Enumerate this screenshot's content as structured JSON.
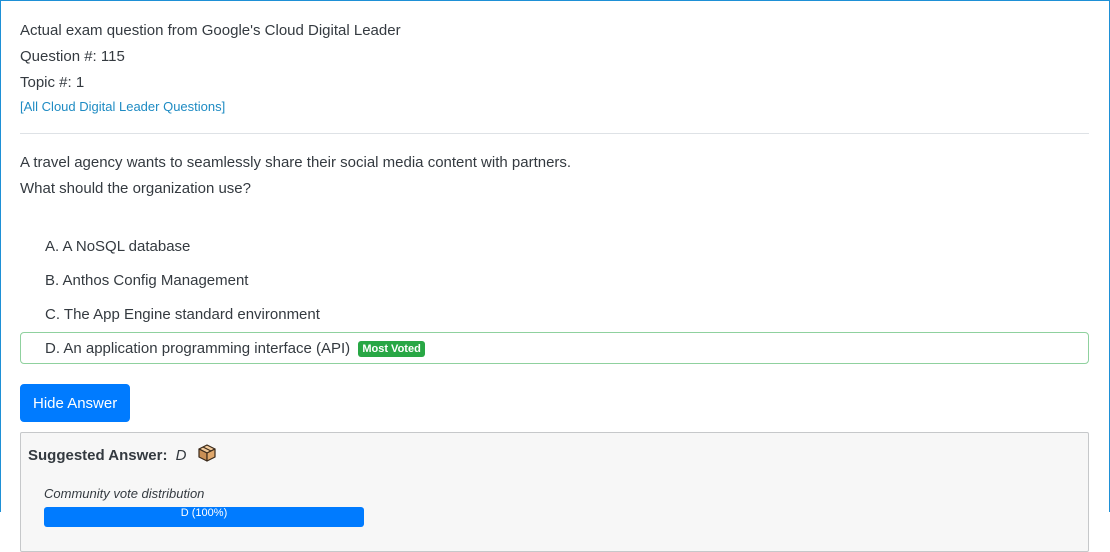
{
  "header": {
    "intro": "Actual exam question from Google's Cloud Digital Leader",
    "question_number": "Question #: 115",
    "topic": "Topic #: 1",
    "all_questions_link": "[All Cloud Digital Leader Questions]"
  },
  "question": {
    "line1": "A travel agency wants to seamlessly share their social media content with partners.",
    "line2": "What should the organization use?"
  },
  "choices": [
    {
      "letter": "A.",
      "text": "A NoSQL database"
    },
    {
      "letter": "B.",
      "text": "Anthos Config Management"
    },
    {
      "letter": "C.",
      "text": "The App Engine standard environment"
    },
    {
      "letter": "D.",
      "text": "An application programming interface (API)",
      "badge": "Most Voted"
    }
  ],
  "answer_button": "Hide Answer",
  "suggested": {
    "label": "Suggested Answer:",
    "value": "D",
    "icon": "cardboard-box-icon"
  },
  "vote": {
    "label": "Community vote distribution",
    "bar_text": "D (100%)",
    "percent": 100
  },
  "colors": {
    "link": "#1e8bc3",
    "button": "#007bff",
    "badge": "#28a745",
    "correct_border": "#8fd19e"
  }
}
